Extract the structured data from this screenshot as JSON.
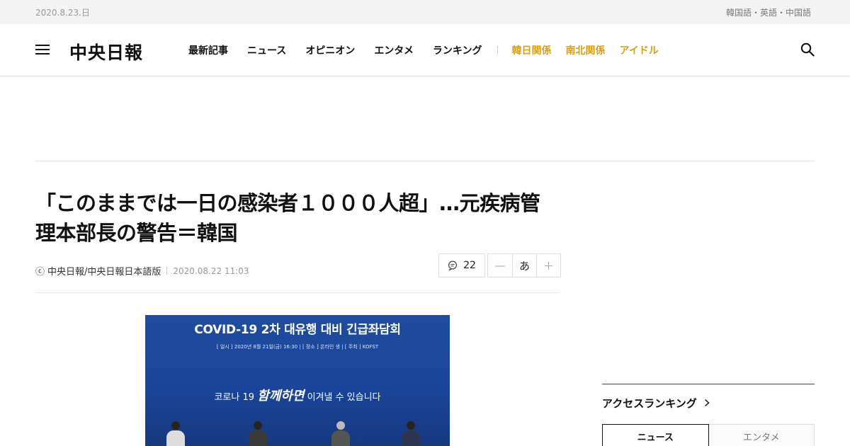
{
  "topbar": {
    "date": "2020.8.23.日",
    "languages": "韓国語・英語・中国語"
  },
  "header": {
    "logo": "中央日報",
    "nav_main": [
      "最新記事",
      "ニュース",
      "オピニオン",
      "エンタメ",
      "ランキング"
    ],
    "nav_featured": [
      "韓日関係",
      "南北関係",
      "アイドル"
    ],
    "accent_color": "#d9a017"
  },
  "article": {
    "title": "「このままでは一日の感染者１０００人超」…元疾病管理本部長の警告＝韓国",
    "copyright_symbol": "ⓒ",
    "source": "中央日報/中央日報日本語版",
    "timestamp": "2020.08.22 11:03",
    "comment_count": "22",
    "font_decrease": "—",
    "font_sample": "あ",
    "font_increase": "＋"
  },
  "photo": {
    "banner_title": "COVID-19 2차 대유행 대비 긴급좌담회",
    "banner_info": "[ 일시 ] 2020년 8월 21일(금) 16:30 | [ 장소 ] 온라인 생 | [ 주최 ] KOFST",
    "slogan_prefix": "코로나 19",
    "slogan_emphasis": "함께하면",
    "slogan_suffix": "이겨낼 수 있습니다"
  },
  "sidebar": {
    "ranking_title": "アクセスランキング",
    "ranking_tabs": [
      "ニュース",
      "エンタメ"
    ]
  }
}
